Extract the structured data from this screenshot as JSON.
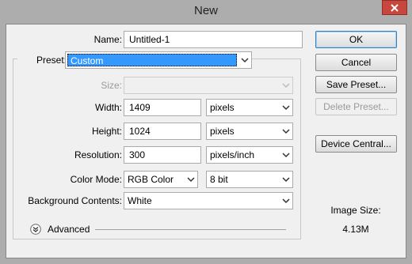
{
  "window": {
    "title": "New"
  },
  "fields": {
    "name_label": "Name:",
    "name_value": "Untitled-1",
    "preset_label": "Preset:",
    "preset_value": "Custom",
    "size_label": "Size:",
    "width_label": "Width:",
    "width_value": "1409",
    "width_unit": "pixels",
    "height_label": "Height:",
    "height_value": "1024",
    "height_unit": "pixels",
    "resolution_label": "Resolution:",
    "resolution_value": "300",
    "resolution_unit": "pixels/inch",
    "color_mode_label": "Color Mode:",
    "color_mode_value": "RGB Color",
    "bit_depth_value": "8 bit",
    "background_label": "Background Contents:",
    "background_value": "White",
    "advanced_label": "Advanced"
  },
  "buttons": {
    "ok": "OK",
    "cancel": "Cancel",
    "save_preset": "Save Preset...",
    "delete_preset": "Delete Preset...",
    "device_central": "Device Central..."
  },
  "info": {
    "image_size_label": "Image Size:",
    "image_size_value": "4.13M"
  },
  "icons": {
    "close": "close-icon",
    "dropdown": "chevron-down-icon",
    "advanced": "expand-double-chevron-icon"
  },
  "colors": {
    "selection": "#3399ff",
    "close_button": "#c7463d",
    "dialog_bg": "#f0f0f0",
    "frame_bg": "#adadad"
  }
}
